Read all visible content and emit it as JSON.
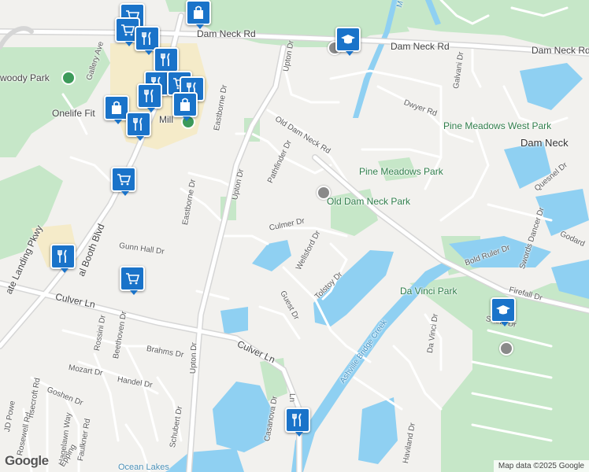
{
  "map": {
    "attribution": "Map data ©2025 Google",
    "logo": "Google",
    "colors": {
      "land": "#f2f1ee",
      "park": "#c6e7c8",
      "water": "#8fd0f2",
      "road": "#ffffff",
      "major_road": "#e6e6e6",
      "commercial": "#f5ebc9",
      "pin": "#1a73c9"
    }
  },
  "labels": {
    "dam_neck_rd_w": "Dam Neck Rd",
    "dam_neck_rd_e": "Dam Neck Rd",
    "dam_neck_area": "Dam Neck",
    "upton_dr_n": "Upton Dr",
    "upton_dr_mid": "Upton Dr",
    "upton_dr_s": "Upton Dr",
    "old_dam_neck_rd": "Old Dam Neck Rd",
    "pathfinder_dr": "Pathfinder Dr",
    "eastborne_dr_n": "Eastborne Dr",
    "eastborne_dr_s": "Eastborne Dr",
    "dwyer_rd": "Dwyer Rd",
    "galvani_dr": "Galvani Dr",
    "pine_meadows_west_park": "Pine Meadows West Park",
    "pine_meadows_park": "Pine Meadows Park",
    "old_dam_neck_park": "Old Dam Neck Park",
    "culmer_dr": "Culmer Dr",
    "wellsford_dr": "Wellsford Dr",
    "tolstoy_dr": "Tolstoy Dr",
    "guest_dr": "Guest Dr",
    "gunn_hall_dr": "Gunn Hall Dr",
    "culver_ln_w": "Culver Ln",
    "culver_ln_e": "Culver Ln",
    "brahms_dr": "Brahms Dr",
    "handel_dr": "Handel Dr",
    "mozart_dr": "Mozart Dr",
    "goshen_dr": "Goshen Dr",
    "rossini_dr": "Rossini Dr",
    "beethoven_dr": "Beethoven Dr",
    "schubert_dr": "Schubert Dr",
    "rosewell_rd": "Rosewell Rd",
    "ashcroft_rd": "nsecroft Rd",
    "jd_powell": "JD Powe",
    "hagelawn_way": "Hagelawn Way",
    "faulkner_rd": "Faulkner Rd",
    "epping": "Epping",
    "casanova_dr": "Casanova Dr",
    "ln_small": "Ln",
    "haviland_dr": "Haviland Dr",
    "da_vinci_dr": "Da Vinci Dr",
    "da_vinci_park": "Da Vinci Park",
    "ashville_bridge_creek": "Ashville Bridge Creek",
    "bold_ruler_dr": "Bold Ruler Dr",
    "swords_dancer_dr": "Swords Dancer Dr",
    "quesnel_dr": "Quesnel Dr",
    "firefall_dr": "Firefall Dr",
    "sann_dr": "S   ann Dr",
    "goodard": "Godard",
    "gallery_ave": "Gallery Ave",
    "owoody_park": "woody Park",
    "onelife_fitness": "Onelife Fit",
    "mill": "Mill",
    "general_booth_blvd": "al Booth Blvd",
    "landing_pkwy": "ate Landing Pkwy",
    "ocean_lakes": "Ocean Lakes",
    "dam_neck_creek": "M"
  },
  "pins": [
    {
      "icon": "shopping-cart-icon"
    },
    {
      "icon": "shopping-cart-icon"
    },
    {
      "icon": "shopping-bag-icon"
    },
    {
      "icon": "restaurant-icon"
    },
    {
      "icon": "restaurant-icon"
    },
    {
      "icon": "school-icon"
    },
    {
      "icon": "restaurant-icon"
    },
    {
      "icon": "shopping-cart-icon"
    },
    {
      "icon": "restaurant-icon"
    },
    {
      "icon": "restaurant-icon"
    },
    {
      "icon": "shopping-bag-icon"
    },
    {
      "icon": "restaurant-icon"
    },
    {
      "icon": "shopping-cart-icon"
    },
    {
      "icon": "restaurant-icon"
    },
    {
      "icon": "shopping-cart-icon"
    },
    {
      "icon": "restaurant-icon"
    },
    {
      "icon": "school-icon"
    },
    {
      "icon": "restaurant-icon"
    }
  ]
}
